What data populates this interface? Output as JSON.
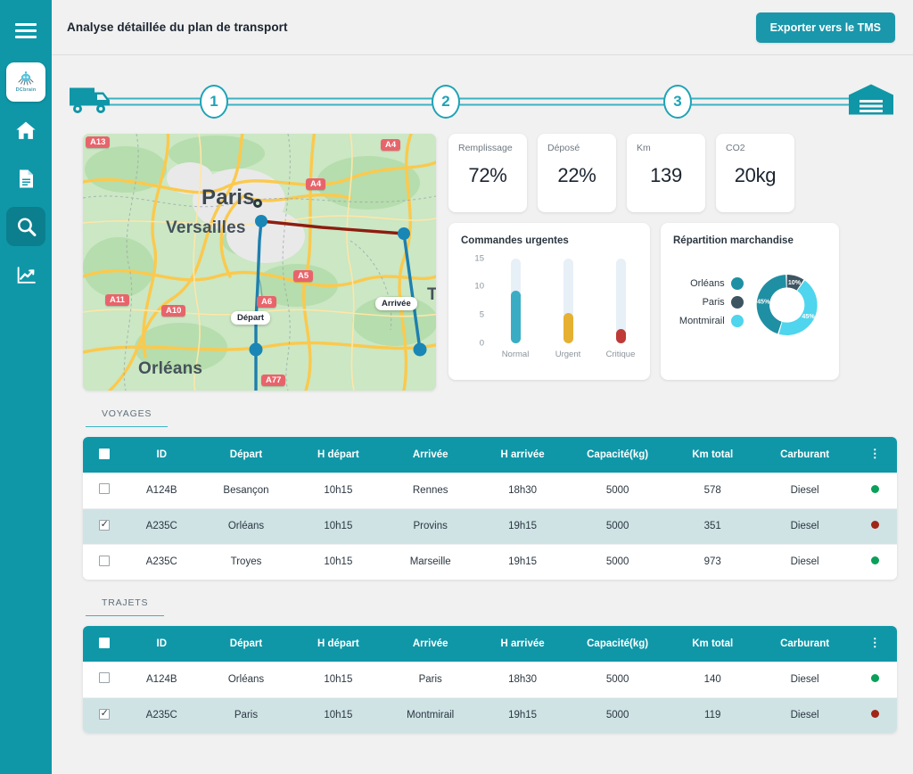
{
  "sidebar": {
    "menu_icon": "hamburger-icon",
    "logo_label": "DCbrain",
    "items": [
      {
        "name": "home",
        "icon": "home-icon",
        "active": false
      },
      {
        "name": "documents",
        "icon": "document-icon",
        "active": false
      },
      {
        "name": "search",
        "icon": "search-icon",
        "active": true
      },
      {
        "name": "analytics",
        "icon": "chart-line-icon",
        "active": false
      }
    ]
  },
  "header": {
    "title": "Analyse détaillée du plan de transport",
    "export_label": "Exporter vers le TMS"
  },
  "stepper": {
    "start_icon": "truck-icon",
    "end_icon": "warehouse-icon",
    "steps": [
      "1",
      "2",
      "3"
    ]
  },
  "kpis": [
    {
      "label": "Remplissage",
      "value": "72%"
    },
    {
      "label": "Déposé",
      "value": "22%"
    },
    {
      "label": "Km",
      "value": "139"
    },
    {
      "label": "CO2",
      "value": "20kg"
    }
  ],
  "map": {
    "cities": [
      "Paris",
      "Versailles",
      "Orléans"
    ],
    "road_shields": [
      "A13",
      "A4",
      "A4",
      "A11",
      "A10",
      "A5",
      "A6",
      "A77"
    ],
    "departure_label": "Départ",
    "arrival_label": "Arrivée"
  },
  "chart_data": [
    {
      "type": "bar",
      "title": "Commandes urgentes",
      "categories": [
        "Normal",
        "Urgent",
        "Critique"
      ],
      "values": [
        10,
        5.7,
        2.7
      ],
      "colors": [
        "#3aadc4",
        "#e6b132",
        "#bf3a36"
      ],
      "track_color": "#e7f0f7",
      "ylabel": "",
      "xlabel": "",
      "ylim": [
        0,
        16
      ],
      "yticks": [
        0,
        5,
        10,
        15
      ],
      "grid": false,
      "legend": "none"
    },
    {
      "type": "pie",
      "title": "Répartition marchandise",
      "variant": "donut",
      "categories": [
        "Orléans",
        "Paris",
        "Montmirail"
      ],
      "values": [
        45,
        10,
        45
      ],
      "labels": [
        "45%",
        "10%",
        "45%"
      ],
      "colors": [
        "#1f8fa3",
        "#3d5561",
        "#4fd5ed"
      ],
      "legend": "left"
    }
  ],
  "tables": [
    {
      "tab_label": "VOYAGES",
      "columns": [
        "",
        "ID",
        "Départ",
        "H départ",
        "Arrivée",
        "H arrivée",
        "Capacité(kg)",
        "Km total",
        "Carburant",
        ""
      ],
      "menu_icon": "kebab-menu-icon",
      "rows": [
        {
          "checked": false,
          "id": "A124B",
          "depart": "Besançon",
          "h_depart": "10h15",
          "arrivee": "Rennes",
          "h_arrivee": "18h30",
          "capacite": "5000",
          "km": "578",
          "carburant": "Diesel",
          "status": "#0aa05a"
        },
        {
          "checked": true,
          "id": "A235C",
          "depart": "Orléans",
          "h_depart": "10h15",
          "arrivee": "Provins",
          "h_arrivee": "19h15",
          "capacite": "5000",
          "km": "351",
          "carburant": "Diesel",
          "status": "#a02617"
        },
        {
          "checked": false,
          "id": "A235C",
          "depart": "Troyes",
          "h_depart": "10h15",
          "arrivee": "Marseille",
          "h_arrivee": "19h15",
          "capacite": "5000",
          "km": "973",
          "carburant": "Diesel",
          "status": "#0aa05a"
        }
      ]
    },
    {
      "tab_label": "TRAJETS",
      "columns": [
        "",
        "ID",
        "Départ",
        "H départ",
        "Arrivée",
        "H arrivée",
        "Capacité(kg)",
        "Km total",
        "Carburant",
        ""
      ],
      "menu_icon": "kebab-menu-icon",
      "rows": [
        {
          "checked": false,
          "id": "A124B",
          "depart": "Orléans",
          "h_depart": "10h15",
          "arrivee": "Paris",
          "h_arrivee": "18h30",
          "capacite": "5000",
          "km": "140",
          "carburant": "Diesel",
          "status": "#0aa05a"
        },
        {
          "checked": true,
          "id": "A235C",
          "depart": "Paris",
          "h_depart": "10h15",
          "arrivee": "Montmirail",
          "h_arrivee": "19h15",
          "capacite": "5000",
          "km": "119",
          "carburant": "Diesel",
          "status": "#a02617"
        }
      ]
    }
  ],
  "colors": {
    "brand_teal": "#0f97a8",
    "accent_teal": "#1a97ab",
    "selected_row": "#cfe3e5",
    "page_bg": "#f1f1f1"
  }
}
